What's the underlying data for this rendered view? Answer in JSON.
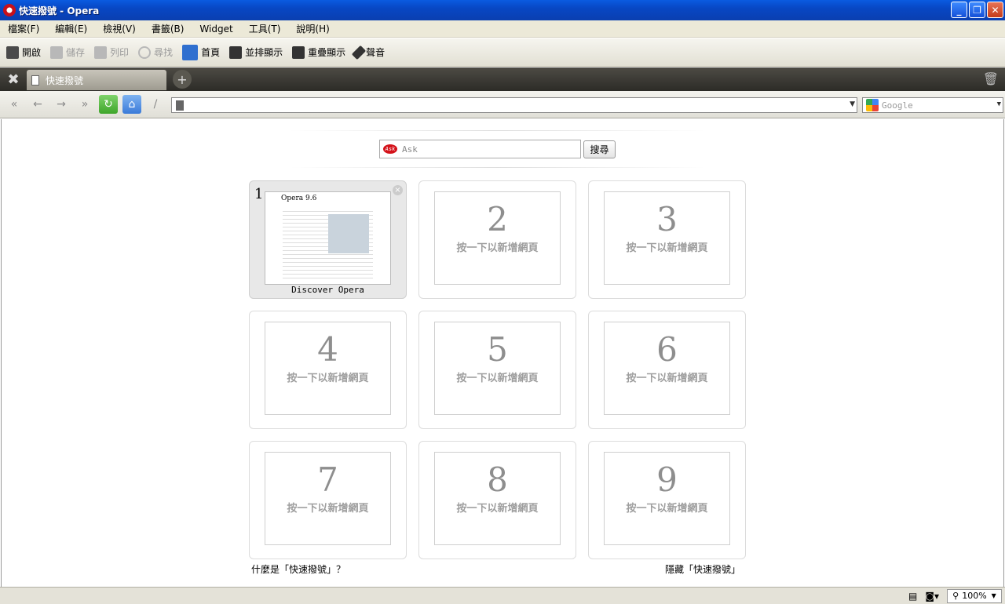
{
  "window": {
    "title": "快速撥號 - Opera",
    "minimize": "_",
    "restore": "❐",
    "close": "✕"
  },
  "menu": [
    "檔案(F)",
    "編輯(E)",
    "檢視(V)",
    "書籤(B)",
    "Widget",
    "工具(T)",
    "說明(H)"
  ],
  "toolbar": {
    "open": "開啟",
    "save": "儲存",
    "print": "列印",
    "find": "尋找",
    "home": "首頁",
    "tile": "並排顯示",
    "cascade": "重疊顯示",
    "voice": "聲音"
  },
  "tabs": [
    {
      "label": "快速撥號"
    }
  ],
  "address": {
    "value": ""
  },
  "search_engine": {
    "placeholder": "Google"
  },
  "speed_dial": {
    "search_placeholder": "Ask",
    "search_button": "搜尋",
    "slots": [
      {
        "number": "1",
        "title": "Discover Opera",
        "filled": true,
        "thumb_heading": "Opera 9.6"
      },
      {
        "number": "2",
        "hint": "按一下以新增網頁"
      },
      {
        "number": "3",
        "hint": "按一下以新增網頁"
      },
      {
        "number": "4",
        "hint": "按一下以新增網頁"
      },
      {
        "number": "5",
        "hint": "按一下以新增網頁"
      },
      {
        "number": "6",
        "hint": "按一下以新增網頁"
      },
      {
        "number": "7",
        "hint": "按一下以新增網頁"
      },
      {
        "number": "8",
        "hint": "按一下以新增網頁"
      },
      {
        "number": "9",
        "hint": "按一下以新增網頁"
      }
    ],
    "what_is_link": "什麼是「快速撥號」？",
    "hide_link": "隱藏「快速撥號」"
  },
  "status": {
    "zoom": "100%"
  }
}
